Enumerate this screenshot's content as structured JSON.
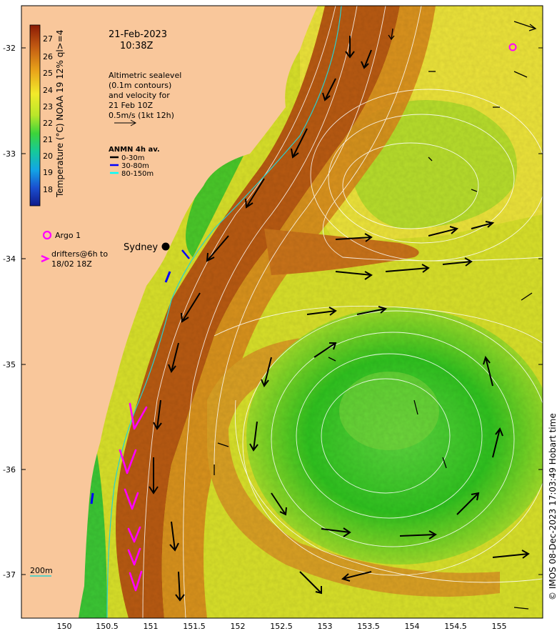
{
  "map": {
    "date": "21-Feb-2023",
    "time": "10:38Z",
    "colorbar_label": "Temperature (°C) NOAA 19 12% ql>=4",
    "colorbar_ticks": [
      "27",
      "26",
      "25",
      "24",
      "23",
      "22",
      "21",
      "20",
      "19",
      "18"
    ],
    "altimetry_note": [
      "Altimetric sealevel",
      "(0.1m contours)",
      "and velocity for",
      "21 Feb 10Z",
      "0.5m/s (1kt 12h)"
    ],
    "anmn_title": "ANMN 4h av.",
    "anmn_items": [
      {
        "label": "0-30m",
        "color": "#000000"
      },
      {
        "label": "30-80m",
        "color": "#0000ff"
      },
      {
        "label": "80-150m",
        "color": "#00ffff"
      }
    ],
    "argo_label": "Argo 1",
    "argo_color": "#ff00ff",
    "drifters_label": [
      "drifters@6h to",
      "18/02 18Z"
    ],
    "drifter_color": "#ff00ff",
    "city_label": "Sydney",
    "isobath_label": "200m",
    "copyright": "© IMOS 08-Dec-2023 17:03:49 Hobart time",
    "lat_ticks": [
      "-32",
      "-33",
      "-34",
      "-35",
      "-36",
      "-37"
    ],
    "lon_ticks": [
      "150",
      "150.5",
      "151",
      "151.5",
      "152",
      "152.5",
      "153",
      "153.5",
      "154",
      "154.5",
      "155"
    ],
    "land_color": "#f9c79b",
    "colors": {
      "warm": "#b45208",
      "mid": "#e0c40a",
      "cool": "#2ec51f"
    }
  }
}
